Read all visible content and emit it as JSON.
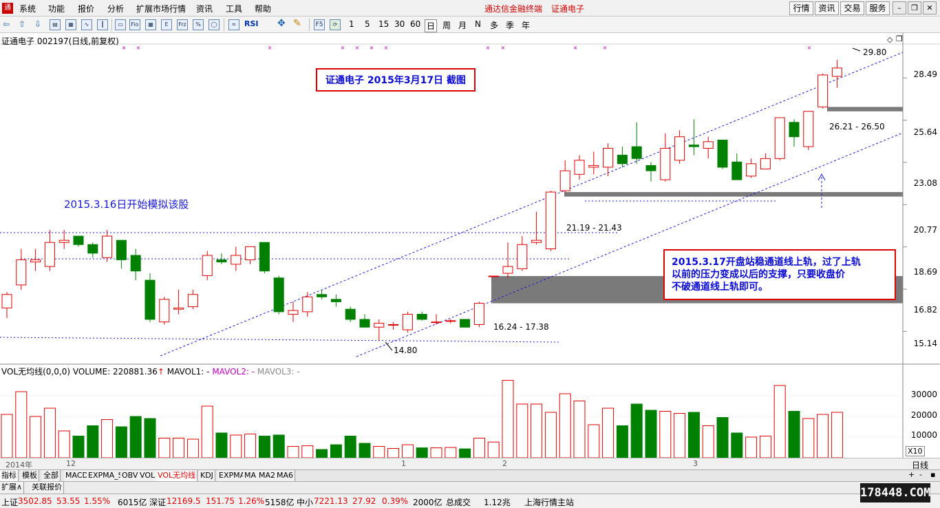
{
  "menubar": {
    "items": [
      "系统",
      "功能",
      "报价",
      "分析",
      "扩展市场行情",
      "资讯",
      "工具",
      "帮助"
    ],
    "app_title": "通达信金融终端",
    "stock_title": "证通电子",
    "right_buttons": [
      "行情",
      "资讯",
      "交易",
      "服务"
    ]
  },
  "toolbar": {
    "periods": [
      "1",
      "5",
      "15",
      "30",
      "60",
      "日",
      "周",
      "月",
      "N",
      "多",
      "季",
      "年"
    ],
    "rsi_label": "RSI",
    "f5_label": "F5"
  },
  "chart": {
    "header": "证通电子 002197(日线,前复权)",
    "price_labels": [
      "28.49",
      "25.64",
      "23.08",
      "20.77",
      "18.69",
      "16.82",
      "15.14"
    ],
    "annotation_box": "证通电子  2015年3月17日 截图",
    "left_note": "2015.3.16日开始模拟该股",
    "right_note_lines": [
      "2015.3.17开盘站稳通道线上轨，过了上轨",
      "以前的压力变成以后的支撑，只要收盘价",
      "不破通道线上轨即可。"
    ],
    "high_label": "29.80",
    "low_label": "14.80",
    "gap_labels": [
      "26.21 - 26.50",
      "21.19 - 21.43",
      "16.24 - 17.38"
    ],
    "accent_up": "#e00000",
    "accent_down": "#008000"
  },
  "volume": {
    "title": "VOL无均线(0,0,0)",
    "volume_text": "VOLUME: 220881.36",
    "mavol1": "MAVOL1: -",
    "mavol2": "MAVOL2: -",
    "mavol3": "MAVOL3: -",
    "axis_labels": [
      "30000",
      "20000",
      "10000"
    ],
    "unit": "X10"
  },
  "datebar": {
    "labels": [
      "2014年",
      "12",
      "1",
      "2",
      "3"
    ],
    "period_label": "日线"
  },
  "tabs": [
    "指标",
    "模板",
    "全部",
    "MACD",
    "EXPMA_S",
    "OBV",
    "VOL",
    "VOL无均线",
    "KDJ",
    "EXPMA",
    "MA",
    "MA2",
    "MA6"
  ],
  "subtabs": [
    "扩展∧",
    "关联报价"
  ],
  "status": {
    "sh_label": "上证",
    "sh_value": "3502.85",
    "sh_change": "53.55",
    "sh_pct": "1.55%",
    "sh_amount": "6015亿",
    "sz_label": "深证",
    "sz_value": "12169.5",
    "sz_change": "151.75",
    "sz_pct": "1.26%",
    "sz_amount": "5158亿",
    "zx_label": "中小",
    "zx_value": "7221.13",
    "zx_change": "27.92",
    "zx_pct": "0.39%",
    "zx_amount": "2000亿",
    "total_label": "总成交",
    "total_value": "1.12兆",
    "server": "上海行情主站"
  },
  "watermark": "178448.COM",
  "chart_data": {
    "type": "candlestick",
    "scale": "log",
    "ylim": [
      14.0,
      31.0
    ],
    "candles": [
      {
        "o": 16.05,
        "h": 16.7,
        "l": 15.65,
        "c": 16.6
      },
      {
        "o": 17.0,
        "h": 18.6,
        "l": 16.8,
        "c": 18.1
      },
      {
        "o": 18.0,
        "h": 18.6,
        "l": 17.6,
        "c": 18.1
      },
      {
        "o": 17.8,
        "h": 19.5,
        "l": 17.6,
        "c": 18.9
      },
      {
        "o": 18.9,
        "h": 19.5,
        "l": 18.6,
        "c": 19.0
      },
      {
        "o": 19.2,
        "h": 19.2,
        "l": 18.7,
        "c": 18.8
      },
      {
        "o": 18.8,
        "h": 18.9,
        "l": 18.2,
        "c": 18.4
      },
      {
        "o": 18.2,
        "h": 19.5,
        "l": 18.0,
        "c": 19.2
      },
      {
        "o": 19.0,
        "h": 19.0,
        "l": 17.7,
        "c": 18.1
      },
      {
        "o": 18.3,
        "h": 18.6,
        "l": 17.2,
        "c": 17.6
      },
      {
        "o": 17.2,
        "h": 17.5,
        "l": 15.5,
        "c": 15.6
      },
      {
        "o": 15.5,
        "h": 16.5,
        "l": 15.4,
        "c": 16.4
      },
      {
        "o": 16.0,
        "h": 16.8,
        "l": 15.8,
        "c": 16.05
      },
      {
        "o": 16.1,
        "h": 16.8,
        "l": 16.0,
        "c": 16.6
      },
      {
        "o": 17.4,
        "h": 18.5,
        "l": 17.2,
        "c": 18.3
      },
      {
        "o": 18.1,
        "h": 18.4,
        "l": 17.9,
        "c": 18.0
      },
      {
        "o": 17.9,
        "h": 18.7,
        "l": 17.6,
        "c": 18.3
      },
      {
        "o": 18.1,
        "h": 18.7,
        "l": 17.9,
        "c": 18.7
      },
      {
        "o": 18.9,
        "h": 18.9,
        "l": 17.5,
        "c": 17.6
      },
      {
        "o": 17.3,
        "h": 17.4,
        "l": 15.8,
        "c": 15.9
      },
      {
        "o": 15.8,
        "h": 16.3,
        "l": 15.5,
        "c": 15.95
      },
      {
        "o": 15.9,
        "h": 16.7,
        "l": 15.7,
        "c": 16.5
      },
      {
        "o": 16.6,
        "h": 16.8,
        "l": 16.4,
        "c": 16.5
      },
      {
        "o": 16.4,
        "h": 16.6,
        "l": 16.1,
        "c": 16.3
      },
      {
        "o": 16.0,
        "h": 16.1,
        "l": 15.5,
        "c": 15.6
      },
      {
        "o": 15.6,
        "h": 15.8,
        "l": 15.3,
        "c": 15.3
      },
      {
        "o": 15.3,
        "h": 15.6,
        "l": 14.8,
        "c": 15.45
      },
      {
        "o": 15.4,
        "h": 15.5,
        "l": 15.2,
        "c": 15.4
      },
      {
        "o": 15.2,
        "h": 15.9,
        "l": 15.1,
        "c": 15.8
      },
      {
        "o": 15.8,
        "h": 15.9,
        "l": 15.55,
        "c": 15.6
      },
      {
        "o": 15.5,
        "h": 15.8,
        "l": 15.4,
        "c": 15.5
      },
      {
        "o": 15.55,
        "h": 15.6,
        "l": 15.45,
        "c": 15.55
      },
      {
        "o": 15.6,
        "h": 15.6,
        "l": 15.3,
        "c": 15.3
      },
      {
        "o": 15.4,
        "h": 16.3,
        "l": 15.3,
        "c": 16.24
      },
      {
        "o": 17.38,
        "h": 17.38,
        "l": 17.38,
        "c": 17.38
      },
      {
        "o": 17.5,
        "h": 18.9,
        "l": 17.3,
        "c": 17.8
      },
      {
        "o": 17.7,
        "h": 19.2,
        "l": 17.6,
        "c": 18.8
      },
      {
        "o": 18.9,
        "h": 20.4,
        "l": 18.8,
        "c": 19.0
      },
      {
        "o": 18.6,
        "h": 21.5,
        "l": 18.5,
        "c": 21.43
      },
      {
        "o": 21.5,
        "h": 23.2,
        "l": 21.4,
        "c": 22.6
      },
      {
        "o": 22.4,
        "h": 23.5,
        "l": 22.1,
        "c": 23.2
      },
      {
        "o": 22.8,
        "h": 23.7,
        "l": 22.4,
        "c": 22.9
      },
      {
        "o": 22.8,
        "h": 24.2,
        "l": 22.3,
        "c": 23.9
      },
      {
        "o": 23.5,
        "h": 24.0,
        "l": 22.8,
        "c": 23.0
      },
      {
        "o": 24.0,
        "h": 25.5,
        "l": 23.0,
        "c": 23.3
      },
      {
        "o": 22.9,
        "h": 23.1,
        "l": 22.0,
        "c": 22.6
      },
      {
        "o": 22.1,
        "h": 24.8,
        "l": 22.0,
        "c": 23.9
      },
      {
        "o": 23.2,
        "h": 25.0,
        "l": 23.0,
        "c": 24.6
      },
      {
        "o": 24.1,
        "h": 25.7,
        "l": 23.5,
        "c": 24.0
      },
      {
        "o": 23.9,
        "h": 24.6,
        "l": 23.3,
        "c": 24.3
      },
      {
        "o": 24.4,
        "h": 24.4,
        "l": 22.7,
        "c": 22.8
      },
      {
        "o": 23.1,
        "h": 23.6,
        "l": 22.1,
        "c": 22.1
      },
      {
        "o": 22.3,
        "h": 23.3,
        "l": 22.2,
        "c": 23.0
      },
      {
        "o": 22.7,
        "h": 23.6,
        "l": 22.7,
        "c": 23.3
      },
      {
        "o": 23.3,
        "h": 25.8,
        "l": 23.2,
        "c": 25.8
      },
      {
        "o": 25.5,
        "h": 25.7,
        "l": 24.0,
        "c": 24.6
      },
      {
        "o": 24.0,
        "h": 26.21,
        "l": 23.8,
        "c": 26.21
      },
      {
        "o": 26.5,
        "h": 28.8,
        "l": 26.4,
        "c": 28.7
      },
      {
        "o": 28.6,
        "h": 29.8,
        "l": 27.8,
        "c": 29.2
      }
    ],
    "volumes": [
      21000,
      32000,
      20000,
      24000,
      13000,
      10500,
      15500,
      18500,
      15000,
      20000,
      19000,
      9500,
      9500,
      9000,
      25000,
      12000,
      11000,
      11500,
      10500,
      11000,
      5500,
      5800,
      4000,
      6300,
      10500,
      7000,
      5500,
      4500,
      6300,
      4800,
      4800,
      5000,
      4300,
      9500,
      7600,
      37500,
      26000,
      26000,
      22000,
      31000,
      27500,
      16000,
      24000,
      15500,
      26000,
      23000,
      22500,
      21500,
      22000,
      15500,
      19500,
      12000,
      10000,
      10500,
      35000,
      22500,
      19000,
      21000,
      22000
    ]
  }
}
